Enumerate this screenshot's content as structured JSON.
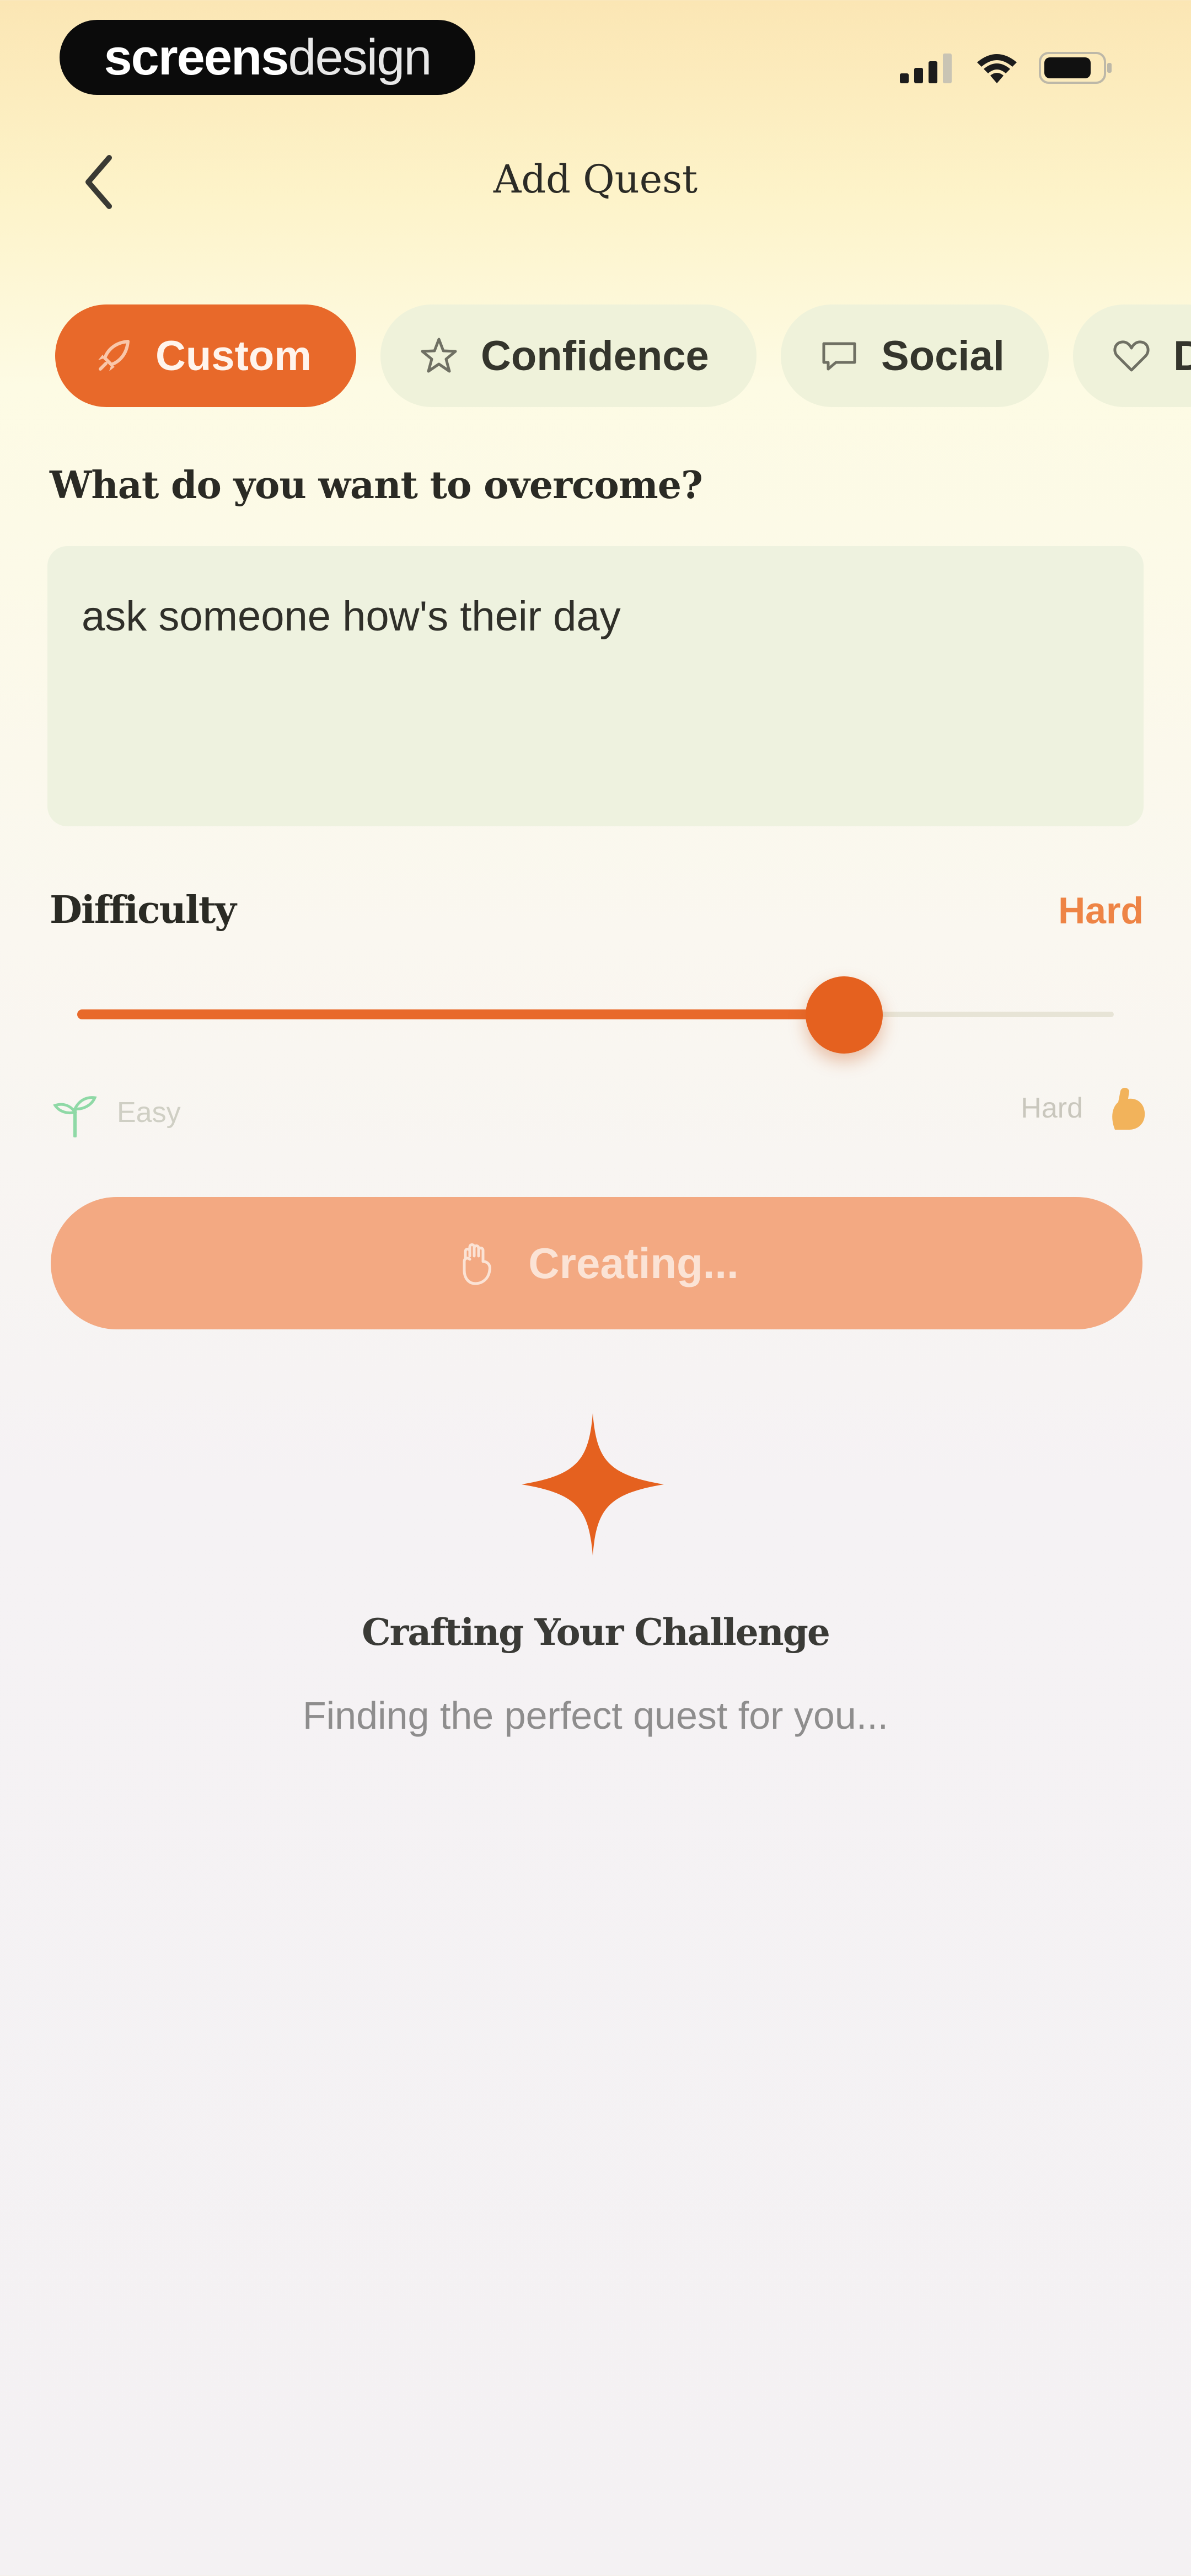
{
  "status_bar": {
    "brand_bold": "screens",
    "brand_light": "design",
    "icons": [
      "cellular-signal-icon",
      "wifi-icon",
      "battery-icon"
    ]
  },
  "header": {
    "title": "Add Quest",
    "back_icon": "chevron-left-icon"
  },
  "categories": [
    {
      "label": "Custom",
      "icon": "rocket-icon",
      "selected": true
    },
    {
      "label": "Confidence",
      "icon": "star-icon",
      "selected": false
    },
    {
      "label": "Social",
      "icon": "chat-icon",
      "selected": false
    },
    {
      "label": "D",
      "icon": "heart-icon",
      "selected": false
    }
  ],
  "question": {
    "label": "What do you want to overcome?",
    "value": "ask someone how's their day"
  },
  "difficulty": {
    "label": "Difficulty",
    "value_label": "Hard",
    "level_fraction": 0.74,
    "min_label": "Easy",
    "max_label": "Hard",
    "min_icon": "sprout-icon",
    "max_icon": "flexed-arm-icon"
  },
  "create_button": {
    "label": "Creating...",
    "icon": "fist-icon"
  },
  "loading": {
    "icon": "sparkle-icon",
    "title": "Crafting Your Challenge",
    "subtitle": "Finding the perfect quest for you..."
  },
  "colors": {
    "accent": "#e8692a",
    "accent_light": "#f3a982",
    "chip_bg": "#eff2da",
    "input_bg": "#eef2df",
    "hard_text": "#ee8445"
  }
}
